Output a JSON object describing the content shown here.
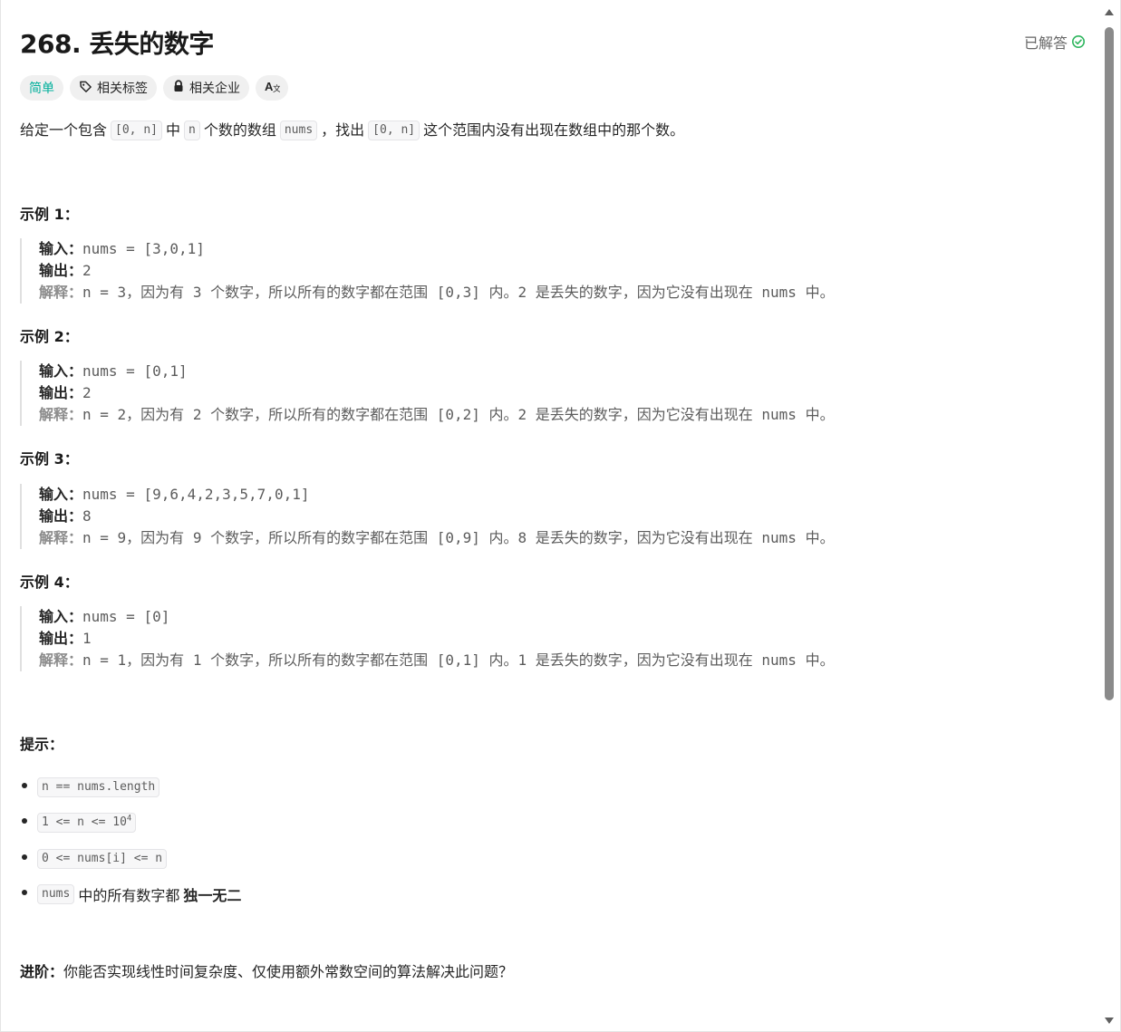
{
  "problem": {
    "title": "268. 丢失的数字",
    "status": "已解答",
    "status_color": "#2db55d"
  },
  "tags": {
    "difficulty": "简单",
    "difficulty_color": "#00af9b",
    "related_tags": "相关标签",
    "related_companies": "相关企业",
    "language_icon": "A文"
  },
  "description": {
    "p1": "给定一个包含",
    "c1": "[0, n]",
    "p2": "中",
    "c2": "n",
    "p3": "个数的数组",
    "c3": "nums",
    "p4": "，找出",
    "c4": "[0, n]",
    "p5": "这个范围内没有出现在数组中的那个数。"
  },
  "examples": [
    {
      "title": "示例 1：",
      "input_label": "输入：",
      "input": "nums = [3,0,1]",
      "output_label": "输出：",
      "output": "2",
      "explanation_label": "解释：",
      "explanation": "n = 3，因为有 3 个数字，所以所有的数字都在范围 [0,3] 内。2 是丢失的数字，因为它没有出现在 nums 中。"
    },
    {
      "title": "示例 2：",
      "input_label": "输入：",
      "input": "nums = [0,1]",
      "output_label": "输出：",
      "output": "2",
      "explanation_label": "解释：",
      "explanation": "n = 2，因为有 2 个数字，所以所有的数字都在范围 [0,2] 内。2 是丢失的数字，因为它没有出现在 nums 中。"
    },
    {
      "title": "示例 3：",
      "input_label": "输入：",
      "input": "nums = [9,6,4,2,3,5,7,0,1]",
      "output_label": "输出：",
      "output": "8",
      "explanation_label": "解释：",
      "explanation": "n = 9，因为有 9 个数字，所以所有的数字都在范围 [0,9] 内。8 是丢失的数字，因为它没有出现在 nums 中。"
    },
    {
      "title": "示例 4：",
      "input_label": "输入：",
      "input": "nums = [0]",
      "output_label": "输出：",
      "output": "1",
      "explanation_label": "解释：",
      "explanation": "n = 1，因为有 1 个数字，所以所有的数字都在范围 [0,1] 内。1 是丢失的数字，因为它没有出现在 nums 中。"
    }
  ],
  "hints": {
    "title": "提示：",
    "h1": "n == nums.length",
    "h2_base": "1 <= n <= 10",
    "h2_exp": "4",
    "h3": "0 <= nums[i] <= n",
    "h4_code": "nums",
    "h4_text": "中的所有数字都",
    "h4_bold": "独一无二"
  },
  "followup": {
    "label": "进阶：",
    "text": "你能否实现线性时间复杂度、仅使用额外常数空间的算法解决此问题？"
  }
}
